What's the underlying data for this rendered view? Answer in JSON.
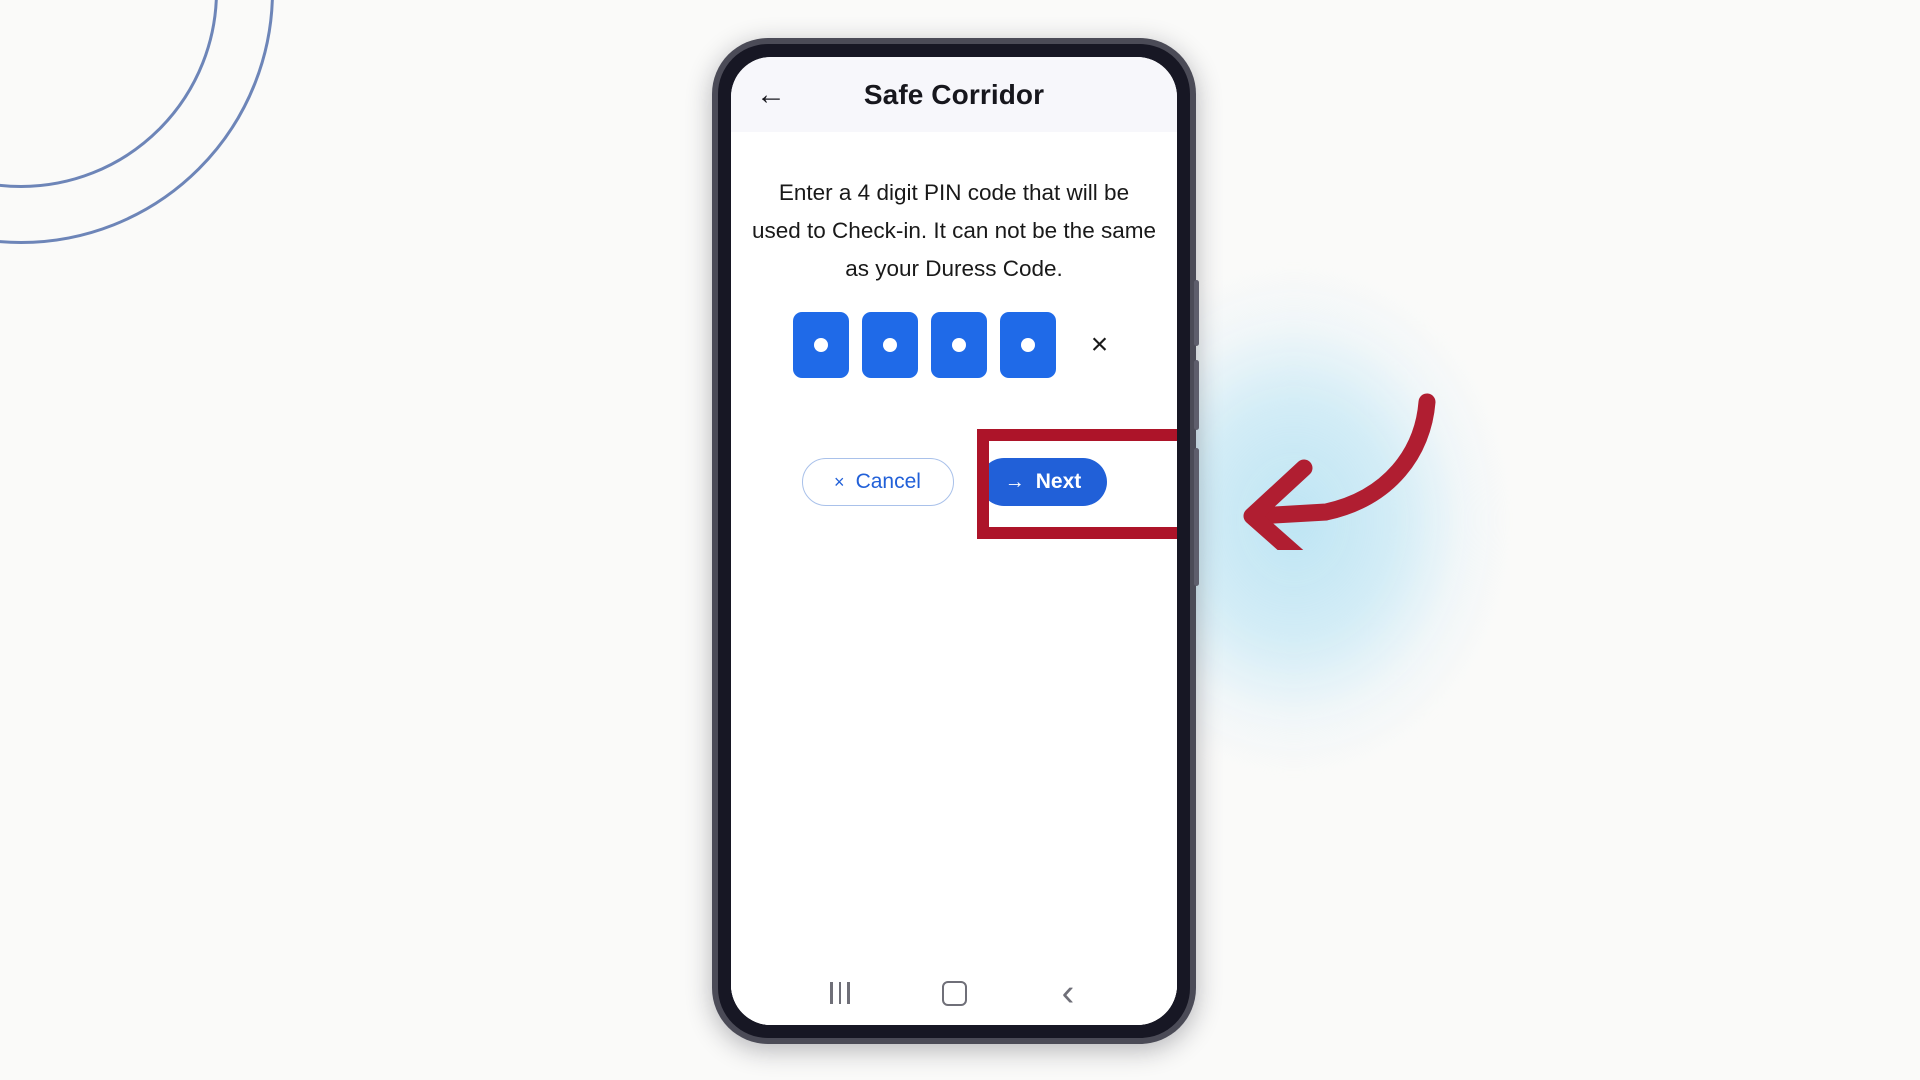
{
  "background": {
    "page_color": "#fafaf9",
    "decor_circle_color": "#6d85b8",
    "decor_blob_color": "#bae3f3"
  },
  "annotation": {
    "arrow_name": "curved-left-arrow",
    "arrow_color": "#b01e31",
    "highlight_color": "#ad1429",
    "highlight_target": "Next"
  },
  "phone": {
    "frame_color": "#4b4b57",
    "bezel_color": "#171724",
    "screen_color": "#ffffff"
  },
  "app": {
    "header": {
      "back_icon": "arrow-left-icon",
      "back_glyph": "←",
      "title": "Safe Corridor",
      "background": "#f7f7fb"
    },
    "instruction": "Enter a 4 digit PIN code that will be used to Check-in. It can not be the same as your Duress Code.",
    "pin": {
      "length": 4,
      "filled_count": 4,
      "mask_character": "●",
      "box_color": "#1f6ae8",
      "dot_color": "#ffffff",
      "clear_icon": "close-x-icon",
      "clear_glyph": "×",
      "boxes": [
        {
          "name": "pin-digit-1",
          "filled": true
        },
        {
          "name": "pin-digit-2",
          "filled": true
        },
        {
          "name": "pin-digit-3",
          "filled": true
        },
        {
          "name": "pin-digit-4",
          "filled": true
        }
      ]
    },
    "actions": {
      "cancel": {
        "label": "Cancel",
        "icon": "close-x-icon",
        "glyph": "×",
        "text_color": "#2160d8",
        "border_color": "#a9c1ea",
        "background": "#ffffff"
      },
      "next": {
        "label": "Next",
        "icon": "arrow-right-icon",
        "glyph": "→",
        "text_color": "#ffffff",
        "background": "#2160d8"
      }
    },
    "android_nav": {
      "recents_label": "Recent apps",
      "home_label": "Home",
      "back_label": "Back",
      "back_glyph": "‹",
      "icon_color": "#6f6f78"
    }
  }
}
